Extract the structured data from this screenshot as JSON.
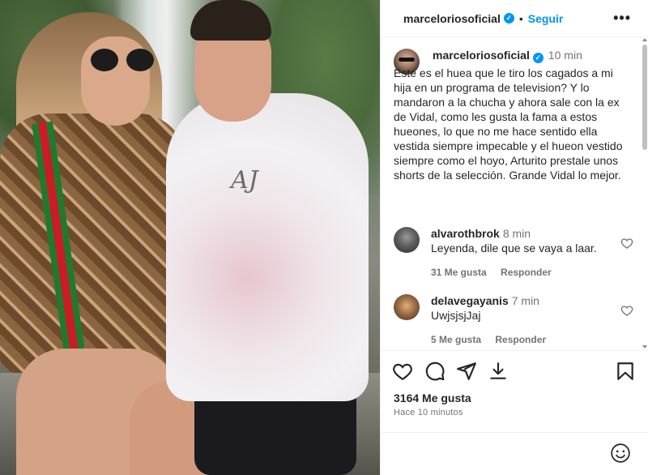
{
  "post": {
    "username": "marceloriosoficial",
    "verified_mark": "✓",
    "separator": "•",
    "follow_label": "Seguir",
    "more_label": "•••"
  },
  "caption": {
    "username": "marceloriosoficial",
    "time": "10 min",
    "text": "Este es el huea que le tiro los cagados a mi hija en un programa de television? Y lo mandaron a la chucha y ahora sale con la ex de Vidal, como les gusta la fama a estos hueones, lo que no me hace sentido ella vestida siempre impecable y el hueon vestido siempre como el hoyo, Arturito prestale unos shorts de la selección. Grande Vidal lo mejor."
  },
  "comments": [
    {
      "username": "alvarothbrok",
      "time": "8 min",
      "text": "Leyenda, dile que se vaya a laar.",
      "likes": "31 Me gusta",
      "reply": "Responder"
    },
    {
      "username": "delavegayanis",
      "time": "7 min",
      "text": "UwjsjsjJaj",
      "likes": "5 Me gusta",
      "reply": "Responder"
    }
  ],
  "photo": {
    "hoodie_logo": "AJ"
  },
  "stats": {
    "likes": "3164 Me gusta",
    "time_ago": "Hace 10 minutos"
  },
  "icons": {
    "like": "heart-icon",
    "comment": "comment-icon",
    "share": "share-icon",
    "download": "download-icon",
    "save": "bookmark-icon",
    "emoji": "emoji-icon"
  },
  "colors": {
    "accent": "#0095f6",
    "muted": "#737373",
    "text": "#262626"
  }
}
